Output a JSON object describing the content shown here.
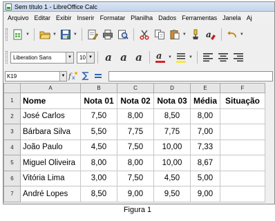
{
  "window": {
    "title": "Sem título 1 - LibreOffice Calc"
  },
  "menu": [
    "Arquivo",
    "Editar",
    "Exibir",
    "Inserir",
    "Formatar",
    "Planilha",
    "Dados",
    "Ferramentas",
    "Janela",
    "Aj"
  ],
  "toolbar": {
    "font_name": "Liberation Sans",
    "font_size": "10"
  },
  "formula_bar": {
    "cell_ref": "K19",
    "content": ""
  },
  "sheet": {
    "columns": [
      "A",
      "B",
      "C",
      "D",
      "E",
      "F"
    ],
    "rows": [
      {
        "n": "1",
        "cells": [
          "Nome",
          "Nota 01",
          "Nota 02",
          "Nota 03",
          "Média",
          "Situação"
        ]
      },
      {
        "n": "2",
        "cells": [
          "José Carlos",
          "7,50",
          "8,00",
          "8,50",
          "8,00",
          ""
        ]
      },
      {
        "n": "3",
        "cells": [
          "Bárbara Silva",
          "5,50",
          "7,75",
          "7,75",
          "7,00",
          ""
        ]
      },
      {
        "n": "4",
        "cells": [
          "João Paulo",
          "4,50",
          "7,50",
          "10,00",
          "7,33",
          ""
        ]
      },
      {
        "n": "5",
        "cells": [
          "Miguel Oliveira",
          "8,00",
          "8,00",
          "10,00",
          "8,67",
          ""
        ]
      },
      {
        "n": "6",
        "cells": [
          "Vitória Lima",
          "3,00",
          "7,50",
          "4,50",
          "5,00",
          ""
        ]
      },
      {
        "n": "7",
        "cells": [
          "André Lopes",
          "8,50",
          "9,00",
          "9,50",
          "9,00",
          ""
        ]
      }
    ]
  },
  "caption": "Figura 1"
}
